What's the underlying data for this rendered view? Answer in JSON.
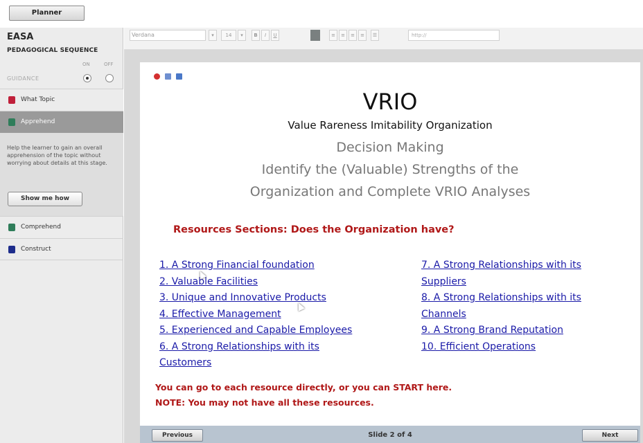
{
  "topbar": {
    "planner_label": "Planner"
  },
  "sidebar": {
    "brand": "EASA",
    "section_title": "PEDAGOGICAL SEQUENCE",
    "guidance_label": "GUIDANCE",
    "on_label": "ON",
    "off_label": "OFF",
    "guidance_state": "on",
    "items": [
      {
        "label": "What Topic",
        "icon": "red-book-icon",
        "color": "#c0203a"
      },
      {
        "label": "Apprehend",
        "icon": "green-book-icon",
        "color": "#2f7d5a",
        "active": true
      },
      {
        "label": "Comprehend",
        "icon": "green-book-icon",
        "color": "#2f7d5a"
      },
      {
        "label": "Construct",
        "icon": "blue-book-icon",
        "color": "#1e2d8c"
      }
    ],
    "apprehend_help": "Help the learner to gain an overall apprehension of the topic without worrying about details at this stage.",
    "show_me_how": "Show me how"
  },
  "toolbar": {
    "font_family": "Verdana",
    "font_size": "14",
    "bold": "B",
    "italic": "I",
    "underline": "U",
    "url_placeholder": "http://"
  },
  "slide": {
    "title": "VRIO",
    "subtitle": "Value Rareness Imitability Organization",
    "line1": "Decision Making",
    "line2": "Identify the (Valuable) Strengths of the",
    "line3": "Organization and Complete VRIO Analyses",
    "resources_heading": "Resources Sections: Does the Organization have?",
    "left_links": [
      "1. A Strong Financial foundation",
      "2. Valuable Facilities",
      "3. Unique and Innovative Products",
      "4. Effective Management",
      "5. Experienced and Capable Employees",
      "6. A Strong Relationships with its",
      "Customers"
    ],
    "right_links": [
      "7. A Strong Relationships with its",
      "Suppliers",
      "8. A Strong Relationships with its",
      "Channels",
      "9. A Strong Brand Reputation",
      "10. Efficient Operations"
    ],
    "note1": "You can go to each resource directly, or you can START here.",
    "note2": "NOTE: You may not have all these resources."
  },
  "bottombar": {
    "previous_label": "Previous",
    "slide_counter": "Slide 2 of 4",
    "next_label": "Next"
  }
}
